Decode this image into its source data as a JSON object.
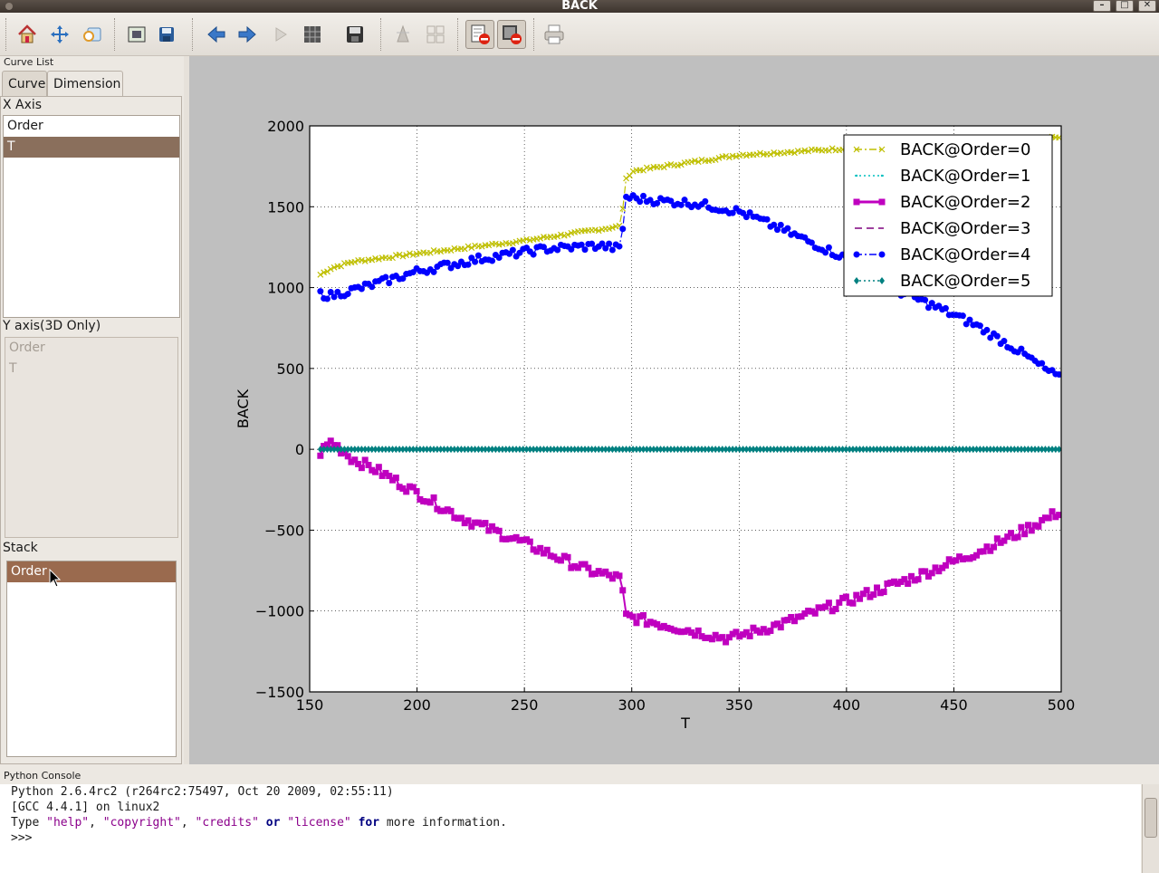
{
  "window": {
    "title": "BACK"
  },
  "toolbar": {
    "icons": [
      "home-icon",
      "pan-icon",
      "zoom-icon",
      "configure-subplots-icon",
      "save-icon",
      "back-arrow-icon",
      "forward-arrow-icon",
      "play-icon",
      "grid-icon",
      "save-figure-icon",
      "filter-icon",
      "layout-icon",
      "remove-curve-icon",
      "remove-all-icon",
      "print-icon"
    ]
  },
  "left_panel": {
    "title": "Curve List",
    "tabs": [
      "Curve",
      "Dimension"
    ],
    "x_axis_label": "X Axis",
    "x_axis_items": [
      "Order",
      "T"
    ],
    "y_axis_label": "Y axis(3D Only)",
    "y_axis_items": [
      "Order",
      "T"
    ],
    "stack_label": "Stack",
    "stack_items": [
      "Order"
    ]
  },
  "console": {
    "title": "Python Console",
    "line1": "Python 2.6.4rc2 (r264rc2:75497, Oct 20 2009, 02:55:11)",
    "line2": "[GCC 4.4.1] on linux2",
    "line3_parts": [
      "Type ",
      "\"help\"",
      ", ",
      "\"copyright\"",
      ", ",
      "\"credits\"",
      " ",
      "or",
      " ",
      "\"license\"",
      " ",
      "for",
      " more information."
    ],
    "prompt": ">>>"
  },
  "chart_data": {
    "type": "line",
    "xlabel": "T",
    "ylabel": "BACK",
    "xlim": [
      155,
      500
    ],
    "ylim": [
      -1500,
      2000
    ],
    "xticks": [
      150,
      200,
      250,
      300,
      350,
      400,
      450,
      500
    ],
    "yticks": [
      2000,
      1500,
      1000,
      500,
      0,
      -500,
      -1000,
      -1500
    ],
    "ytick_labels": [
      "2000",
      "1500",
      "1000",
      "500",
      "0",
      "−500",
      "−1000",
      "−1500"
    ],
    "grid": true,
    "legend_position": "top-right",
    "series": [
      {
        "name": "BACK@Order=0",
        "color": "#bfbf00",
        "marker": "x",
        "linestyle": "dashdot",
        "x": [
          155,
          160,
          170,
          200,
          250,
          295,
          297,
          300,
          350,
          400,
          450,
          500
        ],
        "y": [
          1080,
          1120,
          1160,
          1210,
          1290,
          1380,
          1660,
          1720,
          1820,
          1860,
          1880,
          1930
        ]
      },
      {
        "name": "BACK@Order=1",
        "color": "#00bfbf",
        "marker": "point",
        "linestyle": "dotted",
        "x": [
          155,
          200,
          250,
          300,
          350,
          400,
          450,
          500
        ],
        "y": [
          0,
          0,
          0,
          0,
          0,
          0,
          0,
          0
        ]
      },
      {
        "name": "BACK@Order=2",
        "color": "#bf00bf",
        "marker": "square",
        "linestyle": "solid",
        "x": [
          155,
          160,
          170,
          180,
          200,
          220,
          250,
          280,
          295,
          297,
          310,
          330,
          345,
          370,
          400,
          430,
          460,
          480,
          500
        ],
        "y": [
          -20,
          50,
          -60,
          -120,
          -270,
          -420,
          -580,
          -750,
          -800,
          -1030,
          -1070,
          -1130,
          -1170,
          -1080,
          -940,
          -800,
          -640,
          -520,
          -380
        ]
      },
      {
        "name": "BACK@Order=3",
        "color": "#7f007f",
        "marker": "none",
        "linestyle": "dashed",
        "x": [
          155,
          200,
          250,
          300,
          350,
          400,
          450,
          500
        ],
        "y": [
          0,
          0,
          0,
          0,
          0,
          0,
          0,
          0
        ]
      },
      {
        "name": "BACK@Order=4",
        "color": "#0000ff",
        "marker": "circle",
        "linestyle": "dashdot",
        "x": [
          155,
          160,
          180,
          200,
          230,
          260,
          285,
          295,
          297,
          310,
          330,
          350,
          370,
          400,
          420,
          440,
          460,
          480,
          500
        ],
        "y": [
          960,
          950,
          1020,
          1100,
          1180,
          1240,
          1260,
          1240,
          1560,
          1540,
          1520,
          1470,
          1360,
          1180,
          1000,
          890,
          770,
          610,
          430
        ]
      },
      {
        "name": "BACK@Order=5",
        "color": "#008080",
        "marker": "diamond",
        "linestyle": "dotted",
        "x": [
          155,
          200,
          250,
          300,
          350,
          400,
          450,
          500
        ],
        "y": [
          0,
          0,
          0,
          0,
          0,
          0,
          0,
          0
        ]
      }
    ]
  }
}
